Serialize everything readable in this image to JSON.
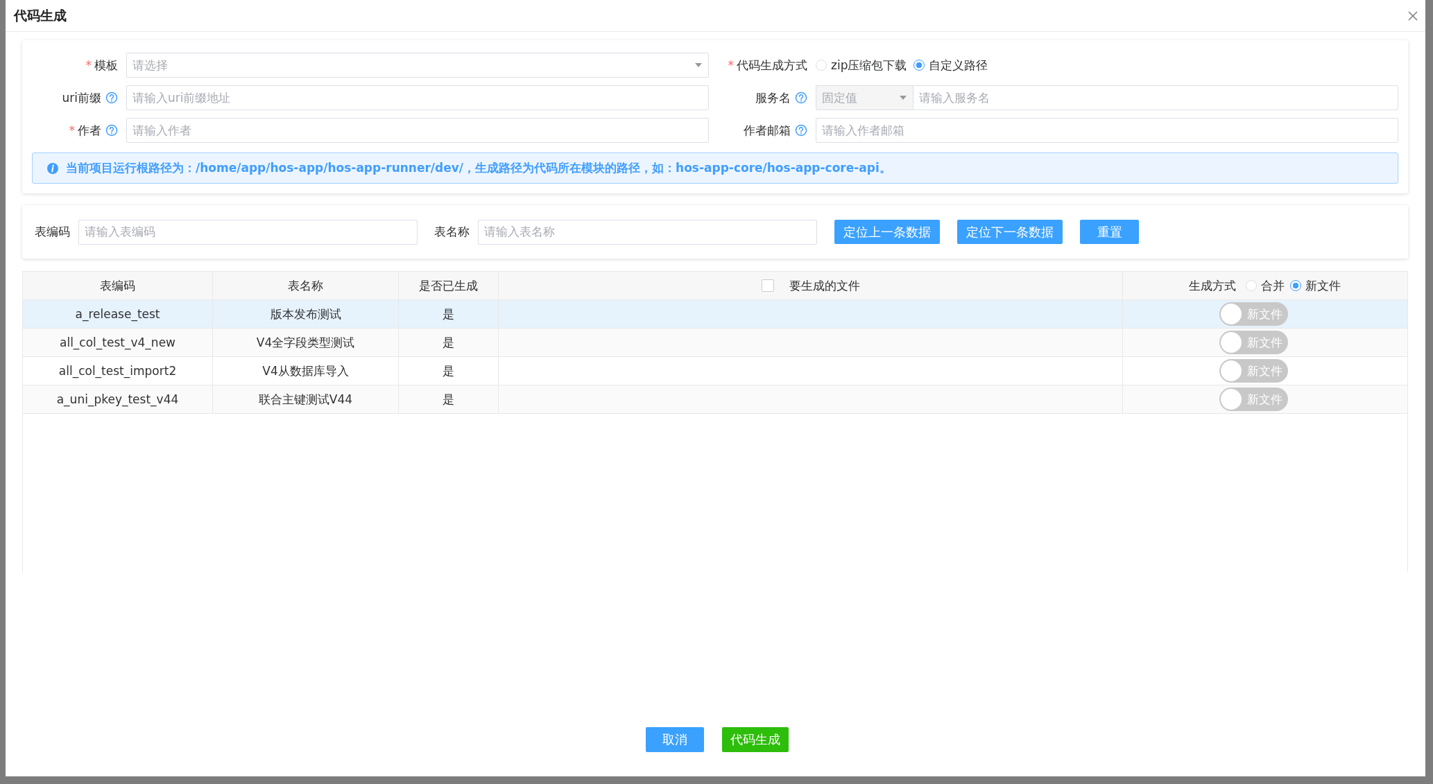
{
  "dialog": {
    "title": "代码生成"
  },
  "form": {
    "fields": [
      {
        "kind": "select",
        "label": "模板",
        "required_mark": "*",
        "help": false,
        "placeholder": "请选择"
      },
      {
        "kind": "radio",
        "label": "代码生成方式",
        "required_mark": "*",
        "help": false,
        "options": [
          {
            "label": "zip压缩包下载",
            "selected": false
          },
          {
            "label": "自定义路径",
            "selected": true
          }
        ]
      },
      {
        "kind": "text",
        "label": "uri前缀",
        "help": true,
        "placeholder": "请输入uri前缀地址"
      },
      {
        "kind": "combo",
        "label": "服务名",
        "help": true,
        "prefix": "固定值",
        "placeholder": "请输入服务名"
      },
      {
        "kind": "text",
        "label": "作者",
        "required_mark": "*",
        "help": true,
        "placeholder": "请输入作者"
      },
      {
        "kind": "text",
        "label": "作者邮箱",
        "help": true,
        "placeholder": "请输入作者邮箱"
      }
    ],
    "notice": "当前项目运行根路径为：/home/app/hos-app/hos-app-runner/dev/，生成路径为代码所在模块的路径，如：hos-app-core/hos-app-core-api。"
  },
  "filter": {
    "fields": [
      {
        "label": "表编码",
        "placeholder": "请输入表编码"
      },
      {
        "label": "表名称",
        "placeholder": "请输入表名称"
      }
    ],
    "buttons": [
      "定位上一条数据",
      "定位下一条数据",
      "重置"
    ]
  },
  "table": {
    "columns": [
      {
        "kind": "text",
        "label": "表编码"
      },
      {
        "kind": "text",
        "label": "表名称"
      },
      {
        "kind": "text",
        "label": "是否已生成"
      },
      {
        "kind": "checkbox",
        "label": "要生成的文件",
        "checked": false
      },
      {
        "kind": "radio",
        "label": "生成方式",
        "options": [
          {
            "label": "合并",
            "selected": false
          },
          {
            "label": "新文件",
            "selected": true
          }
        ]
      }
    ],
    "rows": [
      {
        "selected": true,
        "cells": [
          "a_release_test",
          "版本发布测试",
          "是"
        ],
        "files": "",
        "mode": {
          "label": "新文件",
          "on": false
        }
      },
      {
        "selected": false,
        "cells": [
          "all_col_test_v4_new",
          "V4全字段类型测试",
          "是"
        ],
        "files": "",
        "mode": {
          "label": "新文件",
          "on": false
        }
      },
      {
        "selected": false,
        "cells": [
          "all_col_test_import2",
          "V4从数据库导入",
          "是"
        ],
        "files": "",
        "mode": {
          "label": "新文件",
          "on": false
        }
      },
      {
        "selected": false,
        "cells": [
          "a_uni_pkey_test_v44",
          "联合主键测试V44",
          "是"
        ],
        "files": "",
        "mode": {
          "label": "新文件",
          "on": false
        }
      }
    ]
  },
  "footer": {
    "buttons": [
      {
        "kind": "primary",
        "label": "取消"
      },
      {
        "kind": "success",
        "label": "代码生成"
      }
    ]
  }
}
